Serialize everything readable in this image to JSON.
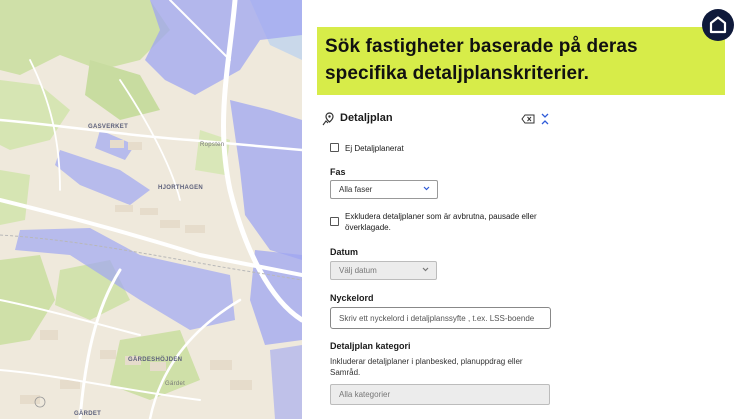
{
  "map": {
    "labels": {
      "gasverket": "GASVERKET",
      "ropsten": "Ropsten",
      "hjorthagen": "HJORTHAGEN",
      "gardeshojden": "GÄRDESHÖJDEN",
      "gardet_small": "Gärdet",
      "gardet": "GÄRDET"
    },
    "colors": {
      "land": "#efe9dc",
      "park": "#cfe0a8",
      "plan": "#9fa6f2",
      "road": "#ffffff",
      "water": "#c9d8ea"
    }
  },
  "headline": {
    "line1": "Sök fastigheter baserade på deras",
    "line2": "specifika detaljplanskriterier.",
    "bg": "#d7ec49"
  },
  "filter": {
    "title": "Detaljplan",
    "icons": {
      "leading": "map-marker-icon",
      "clear": "clear-filter-icon",
      "collapse": "collapse-icon"
    },
    "unplanned_label": "Ej Detaljplanerat",
    "fas": {
      "label": "Fas",
      "selected": "Alla faser"
    },
    "exclude_label_line1": "Exkludera detaljplaner som är avbrutna, pausade eller",
    "exclude_label_line2": "överklagade.",
    "datum": {
      "label": "Datum",
      "placeholder": "Välj datum"
    },
    "nyckelord": {
      "label": "Nyckelord",
      "placeholder": "Skriv ett nyckelord i detaljplanssyfte , t.ex. LSS-boende"
    },
    "kategori": {
      "label": "Detaljplan kategori",
      "desc_line1": "Inkluderar detaljplaner i planbesked, planuppdrag eller",
      "desc_line2": "Samråd.",
      "selected": "Alla kategorier"
    }
  }
}
